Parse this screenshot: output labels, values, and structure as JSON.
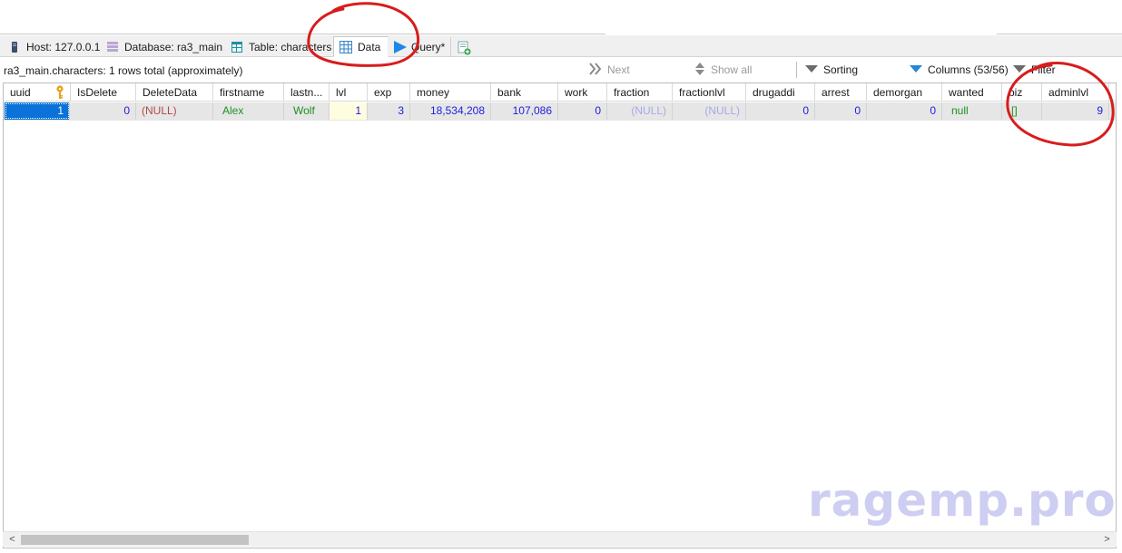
{
  "tabs": [
    {
      "label": "Host: 127.0.0.1",
      "icon": "host-icon"
    },
    {
      "label": "Database: ra3_main",
      "icon": "database-icon"
    },
    {
      "label": "Table: characters",
      "icon": "table-icon"
    },
    {
      "label": "Data",
      "icon": "data-grid-icon",
      "active": true
    },
    {
      "label": "Query*",
      "icon": "query-play-icon"
    }
  ],
  "new_query_icon": "new-query-tab-icon",
  "info": {
    "summary": "ra3_main.characters: 1 rows total (approximately)",
    "next": "Next",
    "show_all": "Show all",
    "sorting": "Sorting",
    "columns": "Columns (53/56)",
    "filter": "Filter"
  },
  "grid": {
    "columns": [
      "uuid",
      "IsDelete",
      "DeleteData",
      "firstname",
      "lastn...",
      "lvl",
      "exp",
      "money",
      "bank",
      "work",
      "fraction",
      "fractionlvl",
      "drugaddi",
      "arrest",
      "demorgan",
      "wanted",
      "biz",
      "adminlvl"
    ],
    "row": [
      "1",
      "0",
      "(NULL)",
      "Alex",
      "Wolf",
      "1",
      "3",
      "18,534,208",
      "107,086",
      "0",
      "(NULL)",
      "(NULL)",
      "0",
      "0",
      "0",
      "null",
      "[]",
      "9"
    ]
  },
  "scrollbar": {
    "left_arrow": "<",
    "right_arrow": ">"
  },
  "watermark": "ragemp.pro",
  "colors": {
    "number": "#1d1de0",
    "text": "#1f8f1f",
    "null": "#b24848",
    "null_faint": "#a8a8e8",
    "selection": "#0a72d8",
    "annotation": "#d81c1c",
    "watermark": "#c6c6f0"
  }
}
